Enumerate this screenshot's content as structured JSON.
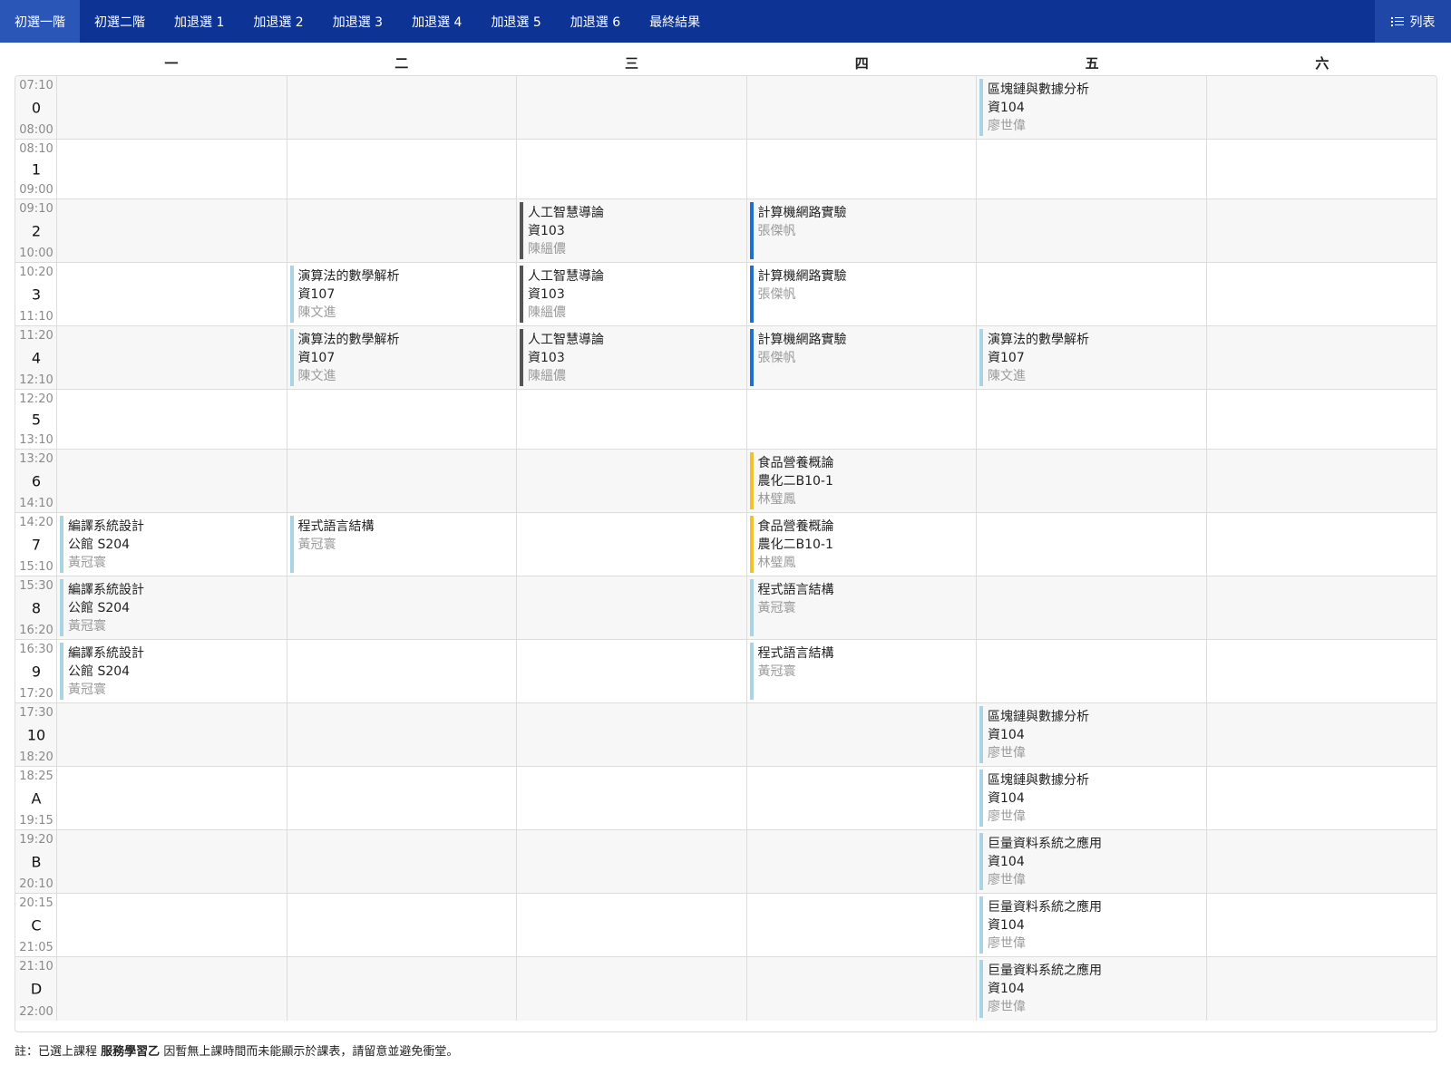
{
  "nav": {
    "tabs": [
      "初選一階",
      "初選二階",
      "加退選 1",
      "加退選 2",
      "加退選 3",
      "加退選 4",
      "加退選 5",
      "加退選 6",
      "最終結果"
    ],
    "active_tab": 0,
    "list_button": "列表"
  },
  "days": [
    "一",
    "二",
    "三",
    "四",
    "五",
    "六"
  ],
  "periods": [
    {
      "start": "07:10",
      "label": "0",
      "end": "08:00"
    },
    {
      "start": "08:10",
      "label": "1",
      "end": "09:00"
    },
    {
      "start": "09:10",
      "label": "2",
      "end": "10:00"
    },
    {
      "start": "10:20",
      "label": "3",
      "end": "11:10"
    },
    {
      "start": "11:20",
      "label": "4",
      "end": "12:10"
    },
    {
      "start": "12:20",
      "label": "5",
      "end": "13:10"
    },
    {
      "start": "13:20",
      "label": "6",
      "end": "14:10"
    },
    {
      "start": "14:20",
      "label": "7",
      "end": "15:10"
    },
    {
      "start": "15:30",
      "label": "8",
      "end": "16:20"
    },
    {
      "start": "16:30",
      "label": "9",
      "end": "17:20"
    },
    {
      "start": "17:30",
      "label": "10",
      "end": "18:20"
    },
    {
      "start": "18:25",
      "label": "A",
      "end": "19:15"
    },
    {
      "start": "19:20",
      "label": "B",
      "end": "20:10"
    },
    {
      "start": "20:15",
      "label": "C",
      "end": "21:05"
    },
    {
      "start": "21:10",
      "label": "D",
      "end": "22:00"
    }
  ],
  "colors": {
    "light_blue": "#a8d4e6",
    "dark_gray": "#555555",
    "blue": "#1f6fd1",
    "yellow": "#f2c12e"
  },
  "courses": [
    {
      "period": 0,
      "day": 4,
      "name": "區塊鏈與數據分析",
      "room": "資104",
      "teacher": "廖世偉",
      "color": "light_blue"
    },
    {
      "period": 2,
      "day": 2,
      "name": "人工智慧導論",
      "room": "資103",
      "teacher": "陳縕儂",
      "color": "dark_gray"
    },
    {
      "period": 2,
      "day": 3,
      "name": "計算機網路實驗",
      "room": "",
      "teacher": "張傑帆",
      "color": "blue"
    },
    {
      "period": 3,
      "day": 1,
      "name": "演算法的數學解析",
      "room": "資107",
      "teacher": "陳文進",
      "color": "light_blue"
    },
    {
      "period": 3,
      "day": 2,
      "name": "人工智慧導論",
      "room": "資103",
      "teacher": "陳縕儂",
      "color": "dark_gray"
    },
    {
      "period": 3,
      "day": 3,
      "name": "計算機網路實驗",
      "room": "",
      "teacher": "張傑帆",
      "color": "blue"
    },
    {
      "period": 4,
      "day": 1,
      "name": "演算法的數學解析",
      "room": "資107",
      "teacher": "陳文進",
      "color": "light_blue"
    },
    {
      "period": 4,
      "day": 2,
      "name": "人工智慧導論",
      "room": "資103",
      "teacher": "陳縕儂",
      "color": "dark_gray"
    },
    {
      "period": 4,
      "day": 3,
      "name": "計算機網路實驗",
      "room": "",
      "teacher": "張傑帆",
      "color": "blue"
    },
    {
      "period": 4,
      "day": 4,
      "name": "演算法的數學解析",
      "room": "資107",
      "teacher": "陳文進",
      "color": "light_blue"
    },
    {
      "period": 6,
      "day": 3,
      "name": "食品營養概論",
      "room": "農化二B10-1",
      "teacher": "林璧鳳",
      "color": "yellow"
    },
    {
      "period": 7,
      "day": 0,
      "name": "編譯系統設計",
      "room": "公館 S204",
      "teacher": "黃冠寰",
      "color": "light_blue"
    },
    {
      "period": 7,
      "day": 1,
      "name": "程式語言結構",
      "room": "",
      "teacher": "黃冠寰",
      "color": "light_blue"
    },
    {
      "period": 7,
      "day": 3,
      "name": "食品營養概論",
      "room": "農化二B10-1",
      "teacher": "林璧鳳",
      "color": "yellow"
    },
    {
      "period": 8,
      "day": 0,
      "name": "編譯系統設計",
      "room": "公館 S204",
      "teacher": "黃冠寰",
      "color": "light_blue"
    },
    {
      "period": 8,
      "day": 3,
      "name": "程式語言結構",
      "room": "",
      "teacher": "黃冠寰",
      "color": "light_blue"
    },
    {
      "period": 9,
      "day": 0,
      "name": "編譯系統設計",
      "room": "公館 S204",
      "teacher": "黃冠寰",
      "color": "light_blue"
    },
    {
      "period": 9,
      "day": 3,
      "name": "程式語言結構",
      "room": "",
      "teacher": "黃冠寰",
      "color": "light_blue"
    },
    {
      "period": 10,
      "day": 4,
      "name": "區塊鏈與數據分析",
      "room": "資104",
      "teacher": "廖世偉",
      "color": "light_blue"
    },
    {
      "period": 11,
      "day": 4,
      "name": "區塊鏈與數據分析",
      "room": "資104",
      "teacher": "廖世偉",
      "color": "light_blue"
    },
    {
      "period": 12,
      "day": 4,
      "name": "巨量資料系統之應用",
      "room": "資104",
      "teacher": "廖世偉",
      "color": "light_blue"
    },
    {
      "period": 13,
      "day": 4,
      "name": "巨量資料系統之應用",
      "room": "資104",
      "teacher": "廖世偉",
      "color": "light_blue"
    },
    {
      "period": 14,
      "day": 4,
      "name": "巨量資料系統之應用",
      "room": "資104",
      "teacher": "廖世偉",
      "color": "light_blue"
    }
  ],
  "note": {
    "prefix": "註：已選上課程",
    "course": "服務學習乙",
    "suffix": "因暫無上課時間而未能顯示於課表，請留意並避免衝堂。"
  }
}
